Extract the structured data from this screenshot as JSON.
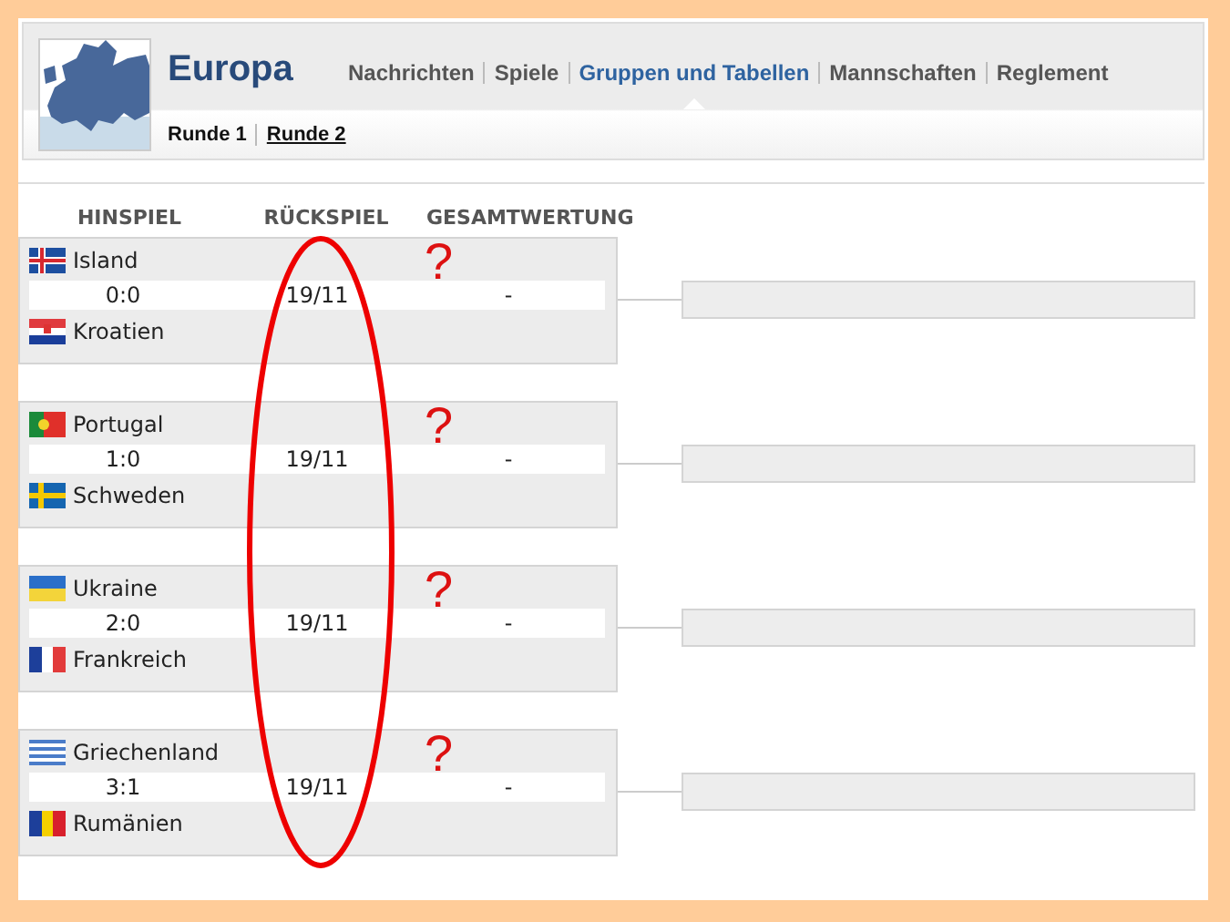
{
  "header": {
    "title": "Europa",
    "nav": [
      {
        "label": "Nachrichten",
        "selected": false
      },
      {
        "label": "Spiele",
        "selected": false
      },
      {
        "label": "Gruppen und Tabellen",
        "selected": true
      },
      {
        "label": "Mannschaften",
        "selected": false
      },
      {
        "label": "Reglement",
        "selected": false
      }
    ],
    "subnav": [
      {
        "label": "Runde 1",
        "selected": true
      },
      {
        "label": "Runde 2",
        "selected": false
      }
    ]
  },
  "columns": [
    "HINSPIEL",
    "RÜCKSPIEL",
    "GESAMTWERTUNG"
  ],
  "matches": [
    {
      "home": {
        "name": "Island",
        "kind": "iceland"
      },
      "away": {
        "name": "Kroatien",
        "kind": "croatia"
      },
      "first_leg": "0:0",
      "second_leg": "19/11",
      "aggregate": "-",
      "annotation": "?"
    },
    {
      "home": {
        "name": "Portugal",
        "kind": "portugal"
      },
      "away": {
        "name": "Schweden",
        "kind": "sweden"
      },
      "first_leg": "1:0",
      "second_leg": "19/11",
      "aggregate": "-",
      "annotation": "?"
    },
    {
      "home": {
        "name": "Ukraine",
        "kind": "ukraine"
      },
      "away": {
        "name": "Frankreich",
        "kind": "france"
      },
      "first_leg": "2:0",
      "second_leg": "19/11",
      "aggregate": "-",
      "annotation": "?"
    },
    {
      "home": {
        "name": "Griechenland",
        "kind": "greece"
      },
      "away": {
        "name": "Rumänien",
        "kind": "romania"
      },
      "first_leg": "3:1",
      "second_leg": "19/11",
      "aggregate": "-",
      "annotation": "?"
    }
  ]
}
